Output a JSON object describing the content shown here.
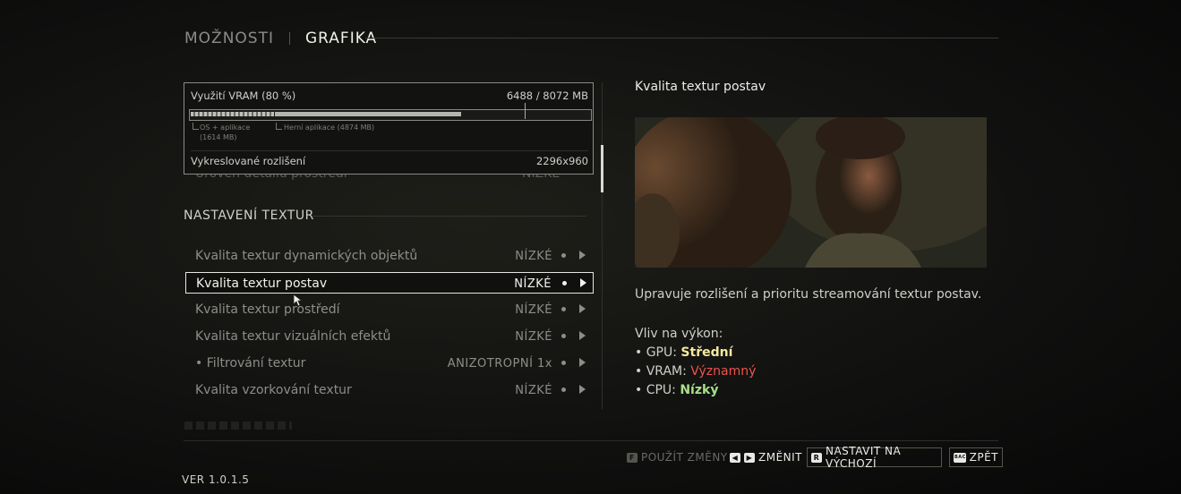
{
  "tabs": [
    {
      "label": "MOŽNOSTI",
      "active": false
    },
    {
      "label": "GRAFIKA",
      "active": true
    }
  ],
  "vram": {
    "label": "Využití VRAM (80 %)",
    "usage": "6488 / 8072 MB",
    "os_note_line1": "OS + aplikace",
    "os_note_line2": "(1614 MB)",
    "game_note": "Herní aplikace (4874 MB)",
    "resolution_label": "Vykreslované rozlišení",
    "resolution_value": "2296x960",
    "fill_fraction": 0.8
  },
  "hidden_row": {
    "label": "Úroveň detailů prostředí",
    "value": "NÍZKÉ"
  },
  "section": {
    "title": "NASTAVENÍ TEXTUR"
  },
  "settings": [
    {
      "label": "Kvalita textur dynamických objektů",
      "value": "NÍZKÉ",
      "selected": false
    },
    {
      "label": "Kvalita textur postav",
      "value": "NÍZKÉ",
      "selected": true
    },
    {
      "label": "Kvalita textur prostředí",
      "value": "NÍZKÉ",
      "selected": false
    },
    {
      "label": "Kvalita textur vizuálních efektů",
      "value": "NÍZKÉ",
      "selected": false
    },
    {
      "label": "• Filtrování textur",
      "value": "ANIZOTROPNÍ 1x",
      "selected": false
    },
    {
      "label": "Kvalita vzorkování textur",
      "value": "NÍZKÉ",
      "selected": false
    }
  ],
  "detail": {
    "title": "Kvalita textur postav",
    "description": "Upravuje rozlišení a prioritu streamování textur postav.",
    "impact_heading": "Vliv na výkon:",
    "gpu_label": "• GPU: ",
    "gpu_value": "Střední",
    "vram_label": "• VRAM: ",
    "vram_value": "Významný",
    "cpu_label": "• CPU: ",
    "cpu_value": "Nízký"
  },
  "footer": {
    "apply_key": "F",
    "apply": "POUŽÍT ZMĚNY",
    "change": "ZMĚNIT",
    "default_key": "R",
    "default": "NASTAVIT NA VÝCHOZÍ",
    "back_key": "BACK",
    "back": "ZPĚT"
  },
  "version": "VER 1.0.1.5"
}
